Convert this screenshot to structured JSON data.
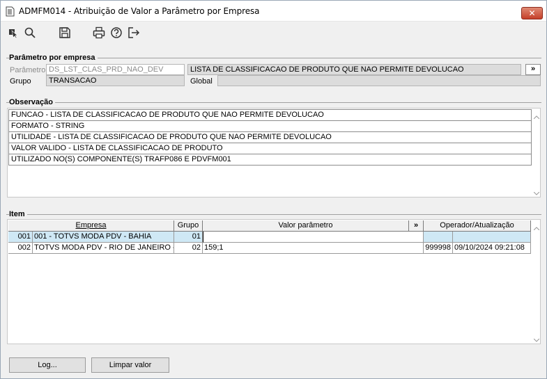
{
  "window": {
    "title": "ADMFM014 - Atribuição de Valor a Parâmetro por Empresa",
    "close_label": "✕"
  },
  "toolbar": {
    "icons": [
      "select-arrow-icon",
      "search-icon",
      "save-icon",
      "print-icon",
      "help-icon",
      "exit-icon"
    ]
  },
  "parametro_empresa": {
    "group_title": "Parâmetro por empresa",
    "parametro_label": "Parâmetro",
    "parametro_value": "DS_LST_CLAS_PRD_NAO_DEV",
    "parametro_desc": "LISTA DE CLASSIFICACAO DE PRODUTO QUE NAO PERMITE DEVOLUCAO",
    "more_label": "»",
    "grupo_label": "Grupo",
    "grupo_value": "TRANSACAO",
    "global_label": "Global",
    "global_value": ""
  },
  "observacao": {
    "group_title": "Observação",
    "lines": [
      "FUNCAO - LISTA DE CLASSIFICACAO DE PRODUTO QUE NAO PERMITE DEVOLUCAO",
      "FORMATO - STRING",
      "UTILIDADE - LISTA DE CLASSIFICACAO DE PRODUTO QUE NAO PERMITE DEVOLUCAO",
      "VALOR VALIDO - LISTA DE CLASSIFICACAO DE PRODUTO",
      "UTILIZADO NO(S) COMPONENTE(S) TRAFP086 E PDVFM001"
    ]
  },
  "item": {
    "group_title": "Item",
    "headers": {
      "empresa": "Empresa",
      "grupo": "Grupo",
      "valor": "Valor parâmetro",
      "more": "»",
      "operador": "Operador/Atualização"
    },
    "rows": [
      {
        "code": "001",
        "empresa": "001 - TOTVS MODA PDV - BAHIA",
        "grupo": "01",
        "valor": "",
        "operador": "",
        "data": "",
        "selected": true
      },
      {
        "code": "002",
        "empresa": "TOTVS MODA PDV - RIO DE JANEIRO - N",
        "grupo": "02",
        "valor": "159;1",
        "operador": "999998",
        "data": "09/10/2024 09:21:08",
        "selected": false
      }
    ]
  },
  "buttons": {
    "log": "Log...",
    "limpar": "Limpar valor"
  },
  "colors": {
    "selected_row": "#cfe8f5",
    "close_button": "#c5402a",
    "disabled_field": "#dcdcdc"
  }
}
